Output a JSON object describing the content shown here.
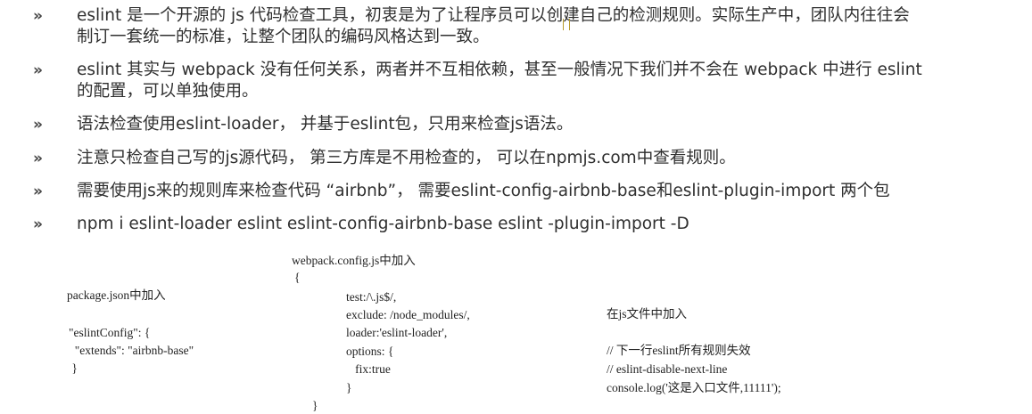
{
  "bullets": [
    {
      "marker": "»",
      "line1": "eslint 是一个开源的 js 代码检查工具，初衷是为了让程序员可以创建自己的检测规则。实际生产中，团队内往往会",
      "line2": "制订一套统一的标准，让整个团队的编码风格达到一致。"
    },
    {
      "marker": "»",
      "line1": "eslint 其实与 webpack 没有任何关系，两者并不互相依赖，甚至一般情况下我们并不会在 webpack 中进行 eslint",
      "line2": "的配置，可以单独使用。"
    },
    {
      "marker": "»",
      "line1": "语法检查使用eslint-loader， 并基于eslint包，只用来检查js语法。"
    },
    {
      "marker": "»",
      "line1": "注意只检查自己写的js源代码， 第三方库是不用检查的， 可以在npmjs.com中查看规则。"
    },
    {
      "marker": "»",
      "line1": "需要使用js来的规则库来检查代码 “airbnb”， 需要eslint-config-airbnb-base和eslint-plugin-import 两个包"
    },
    {
      "marker": "»",
      "line1": "npm i eslint-loader eslint eslint-config-airbnb-base eslint -plugin-import -D"
    }
  ],
  "package_json": {
    "title": "package.json中加入",
    "lines": [
      "\"eslintConfig\": {",
      "  \"extends\": \"airbnb-base\"",
      " }"
    ]
  },
  "webpack": {
    "title": "webpack.config.js中加入",
    "open_brace": "{",
    "lines": [
      "test:/\\.js$/,",
      "exclude: /node_modules/,",
      "loader:'eslint-loader',",
      "options: {",
      "   fix:true",
      "}"
    ],
    "close_brace": "}"
  },
  "jsfile": {
    "title": "在js文件中加入",
    "lines": [
      "// 下一行eslint所有规则失效",
      "// eslint-disable-next-line",
      "console.log('这是入口文件,11111');"
    ]
  }
}
